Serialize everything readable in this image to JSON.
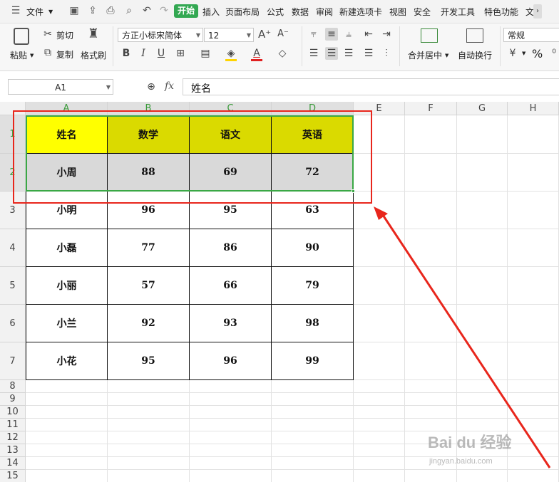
{
  "menu": {
    "file": "文件",
    "tabs": [
      "开始",
      "插入",
      "页面布局",
      "公式",
      "数据",
      "审阅",
      "新建选项卡",
      "视图",
      "安全",
      "开发工具",
      "特色功能",
      "文"
    ]
  },
  "ribbon": {
    "paste": "粘贴",
    "cut": "剪切",
    "copy": "复制",
    "format_painter": "格式刷",
    "font_name": "方正小标宋简体",
    "font_size": "12",
    "merge_center": "合并居中",
    "wrap_text": "自动换行",
    "number_format": "常规",
    "percent": "%"
  },
  "formula_bar": {
    "cell_ref": "A1",
    "fx": "fx",
    "value": "姓名"
  },
  "columns": [
    "A",
    "B",
    "C",
    "D",
    "E",
    "F",
    "G",
    "H"
  ],
  "rows": [
    "1",
    "2",
    "3",
    "4",
    "5",
    "6",
    "7",
    "8",
    "9",
    "10",
    "11",
    "12",
    "13",
    "14",
    "15"
  ],
  "table": {
    "header": [
      "姓名",
      "数学",
      "语文",
      "英语"
    ],
    "rows": [
      [
        "小周",
        "88",
        "69",
        "72"
      ],
      [
        "小明",
        "96",
        "95",
        "63"
      ],
      [
        "小磊",
        "77",
        "86",
        "90"
      ],
      [
        "小丽",
        "57",
        "66",
        "79"
      ],
      [
        "小兰",
        "92",
        "93",
        "98"
      ],
      [
        "小花",
        "95",
        "96",
        "99"
      ]
    ]
  },
  "colors": {
    "accent": "#33a852",
    "header_fill_name": "#ffff00",
    "header_fill": "#dada00",
    "selected_row_fill": "#d9d9d9",
    "annotation": "#e8261c",
    "selection_border": "#3aa845"
  },
  "watermark": {
    "brand": "Bai du 经验",
    "url": "jingyan.baidu.com"
  }
}
